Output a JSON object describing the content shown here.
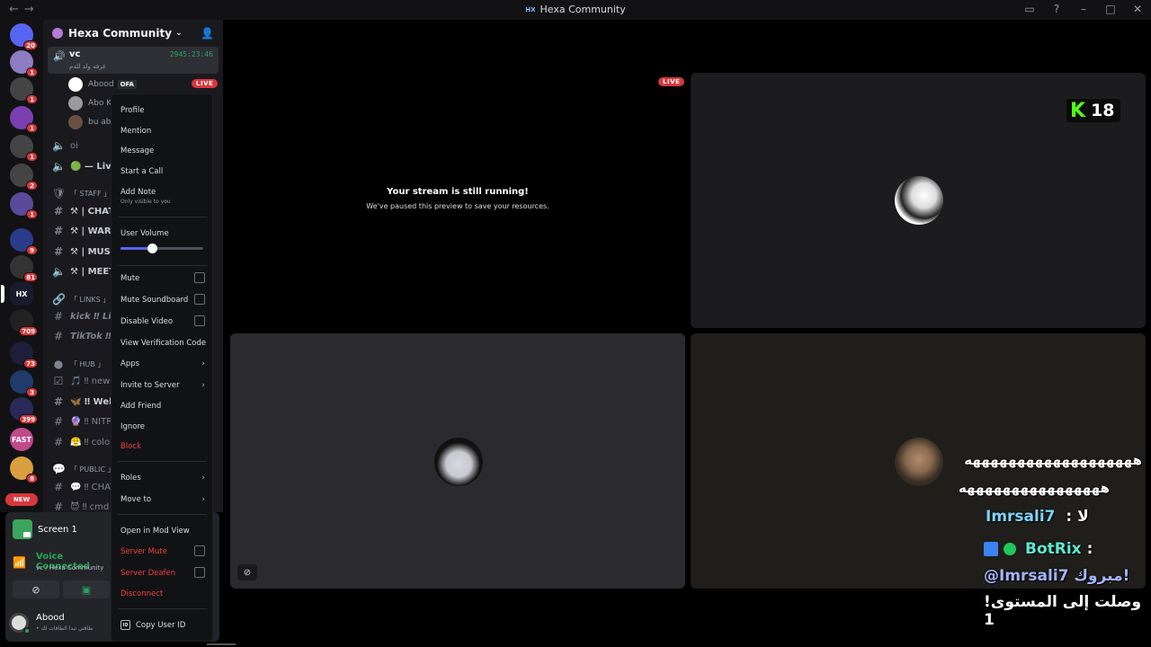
{
  "window": {
    "title": "Hexa Community",
    "logo_text": "HX",
    "nav_back": "←",
    "nav_forward": "→",
    "controls": [
      "inbox-icon",
      "help-icon",
      "minimize",
      "maximize",
      "close"
    ]
  },
  "rail": {
    "servers": [
      {
        "name": "dm-home",
        "badge": "20",
        "color": "#5865f2"
      },
      {
        "name": "server-1",
        "badge": "1",
        "color": "#8e7cc3"
      },
      {
        "name": "server-2",
        "badge": "1",
        "color": "#444"
      },
      {
        "name": "server-3",
        "badge": "1",
        "color": "#7a3fb0"
      },
      {
        "name": "server-4",
        "badge": "1",
        "color": "#444"
      },
      {
        "name": "server-5",
        "badge": "2",
        "color": "#444"
      },
      {
        "name": "server-6",
        "badge": "1",
        "color": "#5a4a9a"
      },
      {
        "name": "server-7",
        "badge": "9",
        "color": "#2a3b8a"
      },
      {
        "name": "server-8",
        "badge": "81",
        "color": "#333"
      },
      {
        "name": "hexa-community",
        "badge": "",
        "color": "#1a1a2e",
        "label": "HX"
      },
      {
        "name": "server-10",
        "badge": "709",
        "color": "#222"
      },
      {
        "name": "server-11",
        "badge": "73",
        "color": "#1e1e3a"
      },
      {
        "name": "server-12",
        "badge": "3",
        "color": "#203a6a"
      },
      {
        "name": "server-13",
        "badge": "399",
        "color": "#2a2a5a"
      },
      {
        "name": "server-14",
        "badge": "",
        "color": "#c04a8a",
        "label": "FAST"
      },
      {
        "name": "server-15",
        "badge": "8",
        "color": "#d8a040"
      }
    ],
    "new_label": "NEW"
  },
  "sidebar": {
    "server_name": "Hexa Community",
    "active_voice": {
      "name": "vc",
      "timer": "2945:23:46",
      "subtitle": "غرفه ولد للدم"
    },
    "voice_users": [
      {
        "name": "Abood",
        "tag": "OFA",
        "live": "LIVE"
      },
      {
        "name": "Abo K",
        "tag": "",
        "live": ""
      },
      {
        "name": "bu abl",
        "tag": "",
        "live": ""
      }
    ],
    "channels": [
      {
        "icon": "🔈",
        "label": "oi",
        "style": ""
      },
      {
        "icon": "🔈",
        "label": "🟢 — Live",
        "style": "bold"
      },
      {
        "icon": "🛡",
        "label": "「 STAFF 」",
        "style": "cat"
      },
      {
        "icon": "#",
        "label": "⚒ | CHAT",
        "style": "bold"
      },
      {
        "icon": "#",
        "label": "⚒ | WARN",
        "style": "bold"
      },
      {
        "icon": "#",
        "label": "⚒ | MUSIC",
        "style": "bold"
      },
      {
        "icon": "🔈",
        "label": "⚒ | MEET",
        "style": "bold"
      },
      {
        "icon": "🔗",
        "label": "「 LINKS 」",
        "style": "cat"
      },
      {
        "icon": "#",
        "label": "kick ‼ Link",
        "style": "ital"
      },
      {
        "icon": "#",
        "label": "TikTok ‼",
        "style": "ital"
      },
      {
        "icon": "●",
        "label": "「 HUB 」",
        "style": "cat"
      },
      {
        "icon": "☑",
        "label": "🎵 ‼ news",
        "style": ""
      },
      {
        "icon": "#",
        "label": "🦋 ‼ Wel",
        "style": "bold"
      },
      {
        "icon": "#",
        "label": "🔮 ‼ NITR",
        "style": ""
      },
      {
        "icon": "#",
        "label": "😤 ‼ colo",
        "style": ""
      },
      {
        "icon": "💬",
        "label": "「 PUBLIC 」",
        "style": "cat"
      },
      {
        "icon": "#",
        "label": "💬 ‼ CHAT",
        "style": ""
      },
      {
        "icon": "#",
        "label": "😈 ‼ cmd",
        "style": ""
      }
    ]
  },
  "panel": {
    "screen_label": "Screen 1",
    "voice_status": "Voice Connected",
    "voice_location": "vc / Hexa Community",
    "username": "Abood",
    "user_status": "• طاقتي تبدأ الطاقات لك"
  },
  "context_menu": {
    "profile": "Profile",
    "mention": "Mention",
    "message": "Message",
    "start_call": "Start a Call",
    "add_note": "Add Note",
    "add_note_sub": "Only visible to you",
    "user_volume": "User Volume",
    "user_volume_level": 0.38,
    "mute": "Mute",
    "mute_soundboard": "Mute Soundboard",
    "disable_video": "Disable Video",
    "view_verification": "View Verification Code",
    "apps": "Apps",
    "invite": "Invite to Server",
    "add_friend": "Add Friend",
    "ignore": "Ignore",
    "block": "Block",
    "roles": "Roles",
    "move_to": "Move to",
    "open_mod_view": "Open in Mod View",
    "server_mute": "Server Mute",
    "server_deafen": "Server Deafen",
    "disconnect": "Disconnect",
    "copy_user_id": "Copy User ID",
    "id_badge": "ID"
  },
  "stage": {
    "live_badge": "LIVE",
    "paused_title": "Your stream is still running!",
    "paused_subtitle": "We've paused this preview to save your resources.",
    "kick_count": "18",
    "kick_logo": "K"
  },
  "chat_overlay": {
    "line1": "هههههههههههههههههههه",
    "line2": "ههههههههههههههههه",
    "line3_user": "Imrsali7",
    "line3_msg": ": لا",
    "line4_user": "BotRix",
    "line4_sep": ":",
    "line5": "@Imrsali7 مبروك!",
    "line6": "!وصلت إلى المستوى 1"
  }
}
